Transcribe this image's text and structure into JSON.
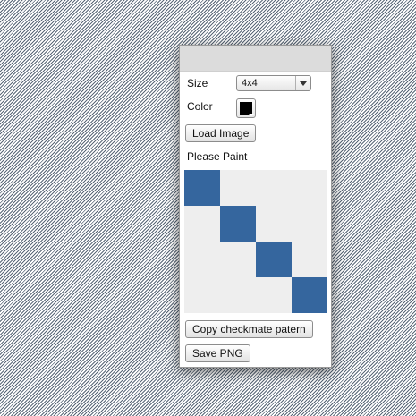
{
  "size": {
    "label": "Size",
    "selected": "4x4"
  },
  "color": {
    "label": "Color",
    "value": "#000000"
  },
  "buttons": {
    "load_image": "Load Image",
    "copy_pattern": "Copy checkmate patern",
    "save_png": "Save PNG"
  },
  "status": "Please Paint",
  "canvas": {
    "rows": 4,
    "cols": 4,
    "paint_color": "#35669e",
    "empty_color": "#eeeeee",
    "cells": [
      [
        1,
        0,
        0,
        0
      ],
      [
        0,
        1,
        0,
        0
      ],
      [
        0,
        0,
        1,
        0
      ],
      [
        0,
        0,
        0,
        1
      ]
    ]
  }
}
